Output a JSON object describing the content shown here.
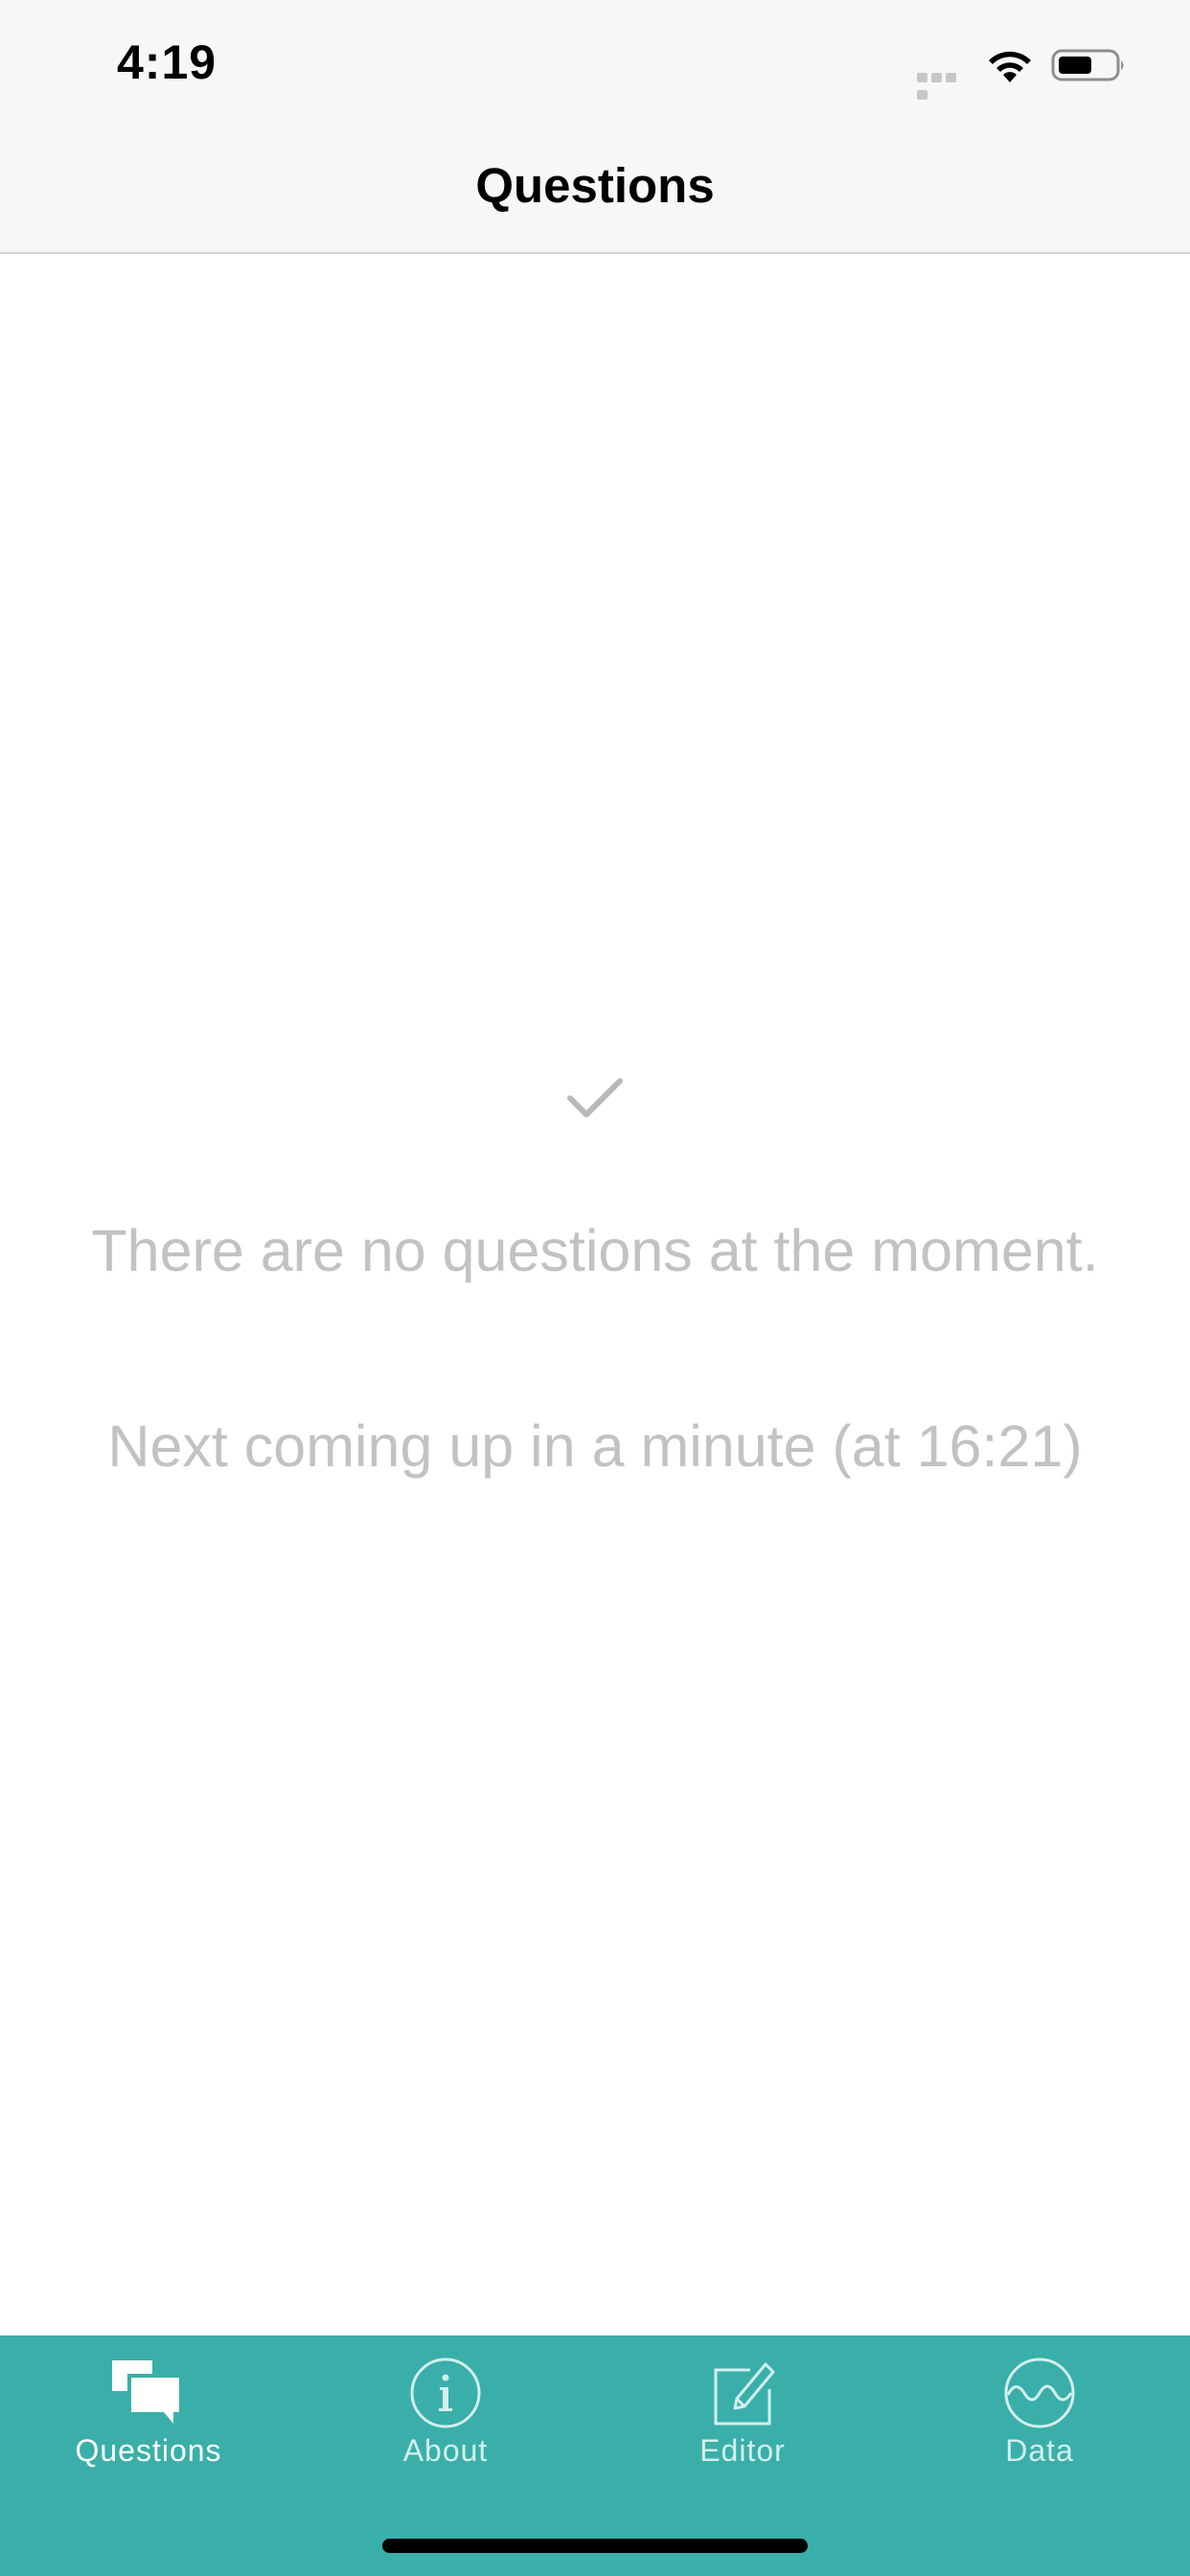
{
  "status_bar": {
    "time": "4:19"
  },
  "nav": {
    "title": "Questions"
  },
  "empty_state": {
    "message": "There are no questions at the moment.",
    "next": "Next coming up in a minute (at 16:21)"
  },
  "tabs": [
    {
      "label": "Questions",
      "icon": "speech-bubbles-icon",
      "active": true
    },
    {
      "label": "About",
      "icon": "info-icon",
      "active": false
    },
    {
      "label": "Editor",
      "icon": "edit-icon",
      "active": false
    },
    {
      "label": "Data",
      "icon": "wave-icon",
      "active": false
    }
  ],
  "colors": {
    "tab_bar": "#3aafa9",
    "muted_text": "#c2c2c2",
    "nav_background": "#f7f7f7"
  }
}
